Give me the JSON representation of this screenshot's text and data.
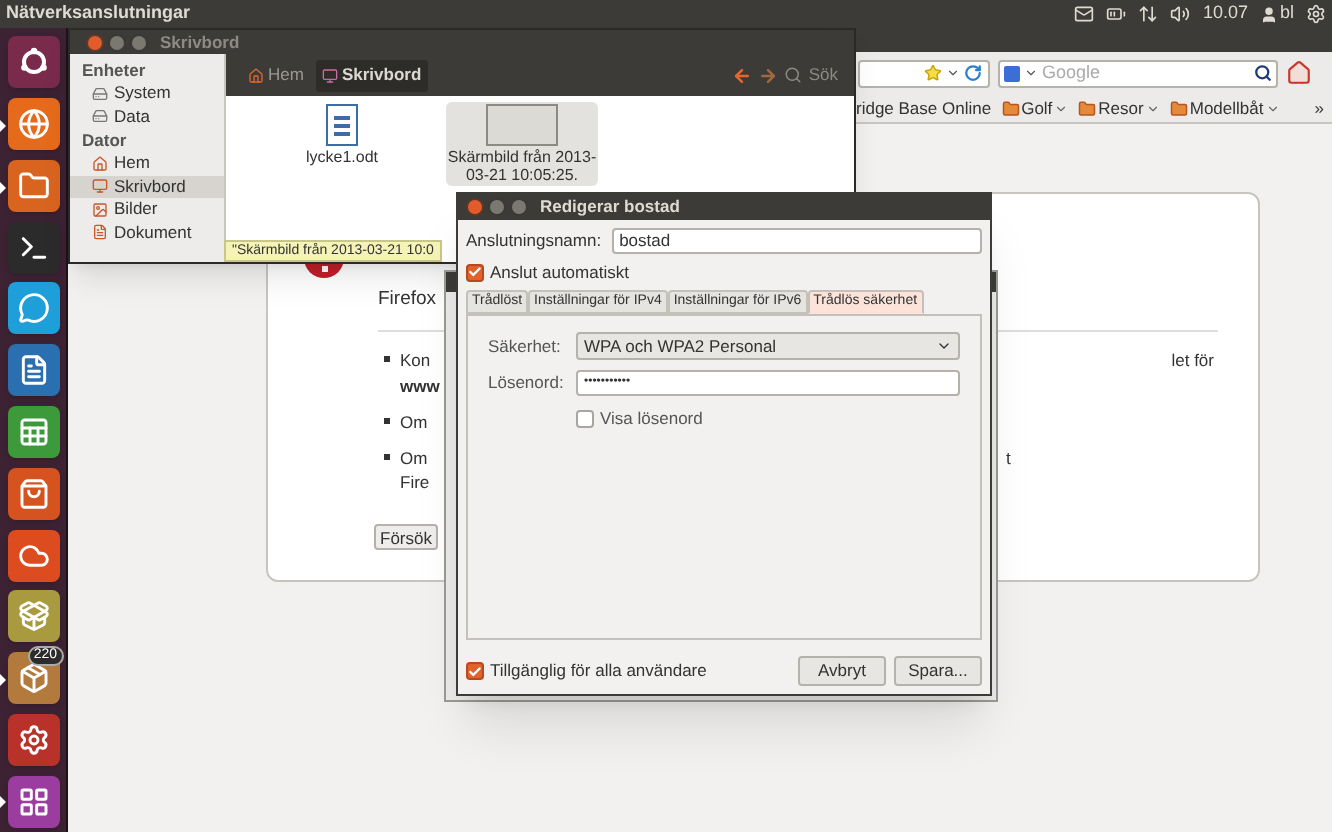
{
  "top_panel": {
    "title": "Nätverksanslutningar",
    "clock": "10.07",
    "user": "bl"
  },
  "launcher": {
    "items": [
      {
        "kind": "dash",
        "running": false
      },
      {
        "kind": "browser",
        "running": true
      },
      {
        "kind": "files",
        "running": true
      },
      {
        "kind": "terminal",
        "running": false
      },
      {
        "kind": "chat",
        "running": false
      },
      {
        "kind": "writer",
        "running": false
      },
      {
        "kind": "calc",
        "running": false
      },
      {
        "kind": "store",
        "running": false
      },
      {
        "kind": "cloud",
        "running": false
      },
      {
        "kind": "download",
        "running": false
      },
      {
        "kind": "updates",
        "running": true,
        "badge": "220"
      },
      {
        "kind": "settings",
        "running": false
      },
      {
        "kind": "workspaces",
        "running": true
      }
    ]
  },
  "browser": {
    "search": {
      "placeholder": "Google"
    },
    "bookmarks": [
      {
        "label": "ridge Base Online",
        "kind": "link"
      },
      {
        "label": "Golf",
        "kind": "folder"
      },
      {
        "label": "Resor",
        "kind": "folder"
      },
      {
        "label": "Modellbåt",
        "kind": "folder"
      }
    ],
    "overflow": "»",
    "error_page": {
      "title": "Firefox",
      "bullets": [
        {
          "lines": [
            "Kon",
            "**www**"
          ],
          "tail": "let för"
        },
        {
          "lines": [
            "Om"
          ]
        },
        {
          "lines": [
            "Om",
            "Fire"
          ],
          "tail": "t"
        }
      ],
      "button": "Försök"
    }
  },
  "files": {
    "title": "Skrivbord",
    "breadcrumbs": [
      {
        "label": "Hem",
        "selected": false
      },
      {
        "label": "Skrivbord",
        "selected": true
      }
    ],
    "search": "Sök",
    "sidebar": [
      {
        "heading": "Enheter",
        "items": [
          {
            "label": "System",
            "kind": "drive",
            "selected": false
          },
          {
            "label": "Data",
            "kind": "drive",
            "selected": false
          }
        ]
      },
      {
        "heading": "Dator",
        "items": [
          {
            "label": "Hem",
            "kind": "home",
            "selected": false
          },
          {
            "label": "Skrivbord",
            "kind": "desktop",
            "selected": true
          },
          {
            "label": "Bilder",
            "kind": "pictures",
            "selected": false
          },
          {
            "label": "Dokument",
            "kind": "documents",
            "selected": false
          }
        ]
      }
    ],
    "items": [
      {
        "name": "lycke1.odt",
        "kind": "document",
        "selected": false
      },
      {
        "name": "Skärmbild från 2013-03-21 10:05:25.",
        "kind": "image",
        "selected": true
      }
    ],
    "tooltip": "\"Skärmbild från 2013-03-21 10:0"
  },
  "dialog": {
    "title": "Redigerar bostad",
    "name_label": "Anslutningsnamn:",
    "name_value": "bostad",
    "auto_connect": {
      "label": "Anslut automatiskt",
      "checked": true
    },
    "tabs": [
      {
        "label": "Trådlöst",
        "selected": false
      },
      {
        "label": "Inställningar för IPv4",
        "selected": false
      },
      {
        "label": "Inställningar för IPv6",
        "selected": false
      },
      {
        "label": "Trådlös säkerhet",
        "selected": true
      }
    ],
    "security_label": "Säkerhet:",
    "security_value": "WPA och WPA2 Personal",
    "password_label": "Lösenord:",
    "password_value": "•••••••••••",
    "show_password": {
      "label": "Visa lösenord",
      "checked": false
    },
    "all_users": {
      "label": "Tillgänglig för alla användare",
      "checked": true
    },
    "buttons": [
      "Avbryt",
      "Spara..."
    ]
  }
}
